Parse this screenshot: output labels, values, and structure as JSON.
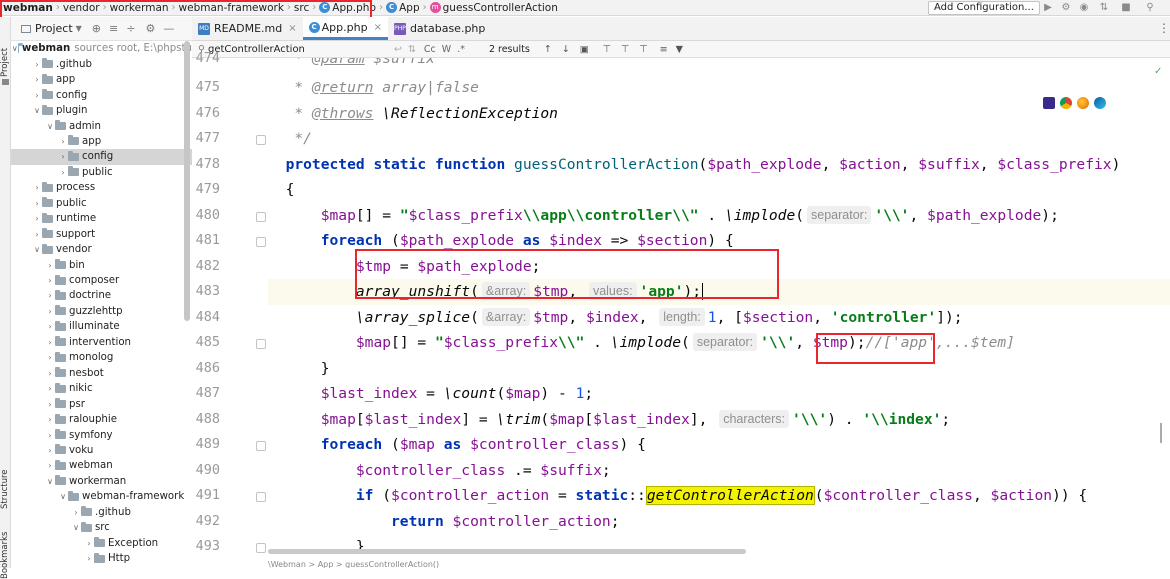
{
  "breadcrumb": [
    "webman",
    "vendor",
    "workerman",
    "webman-framework",
    "src",
    "App.php",
    "App",
    "guessControllerAction"
  ],
  "toolbar": {
    "add_config": "Add Configuration..."
  },
  "project_header": {
    "label": "Project"
  },
  "side_tabs": {
    "project": "Project",
    "structure": "Structure",
    "bookmarks": "Bookmarks"
  },
  "tree": [
    {
      "label": "webman",
      "extra": "sources root, E:\\phpstu",
      "indent": 0,
      "open": true,
      "bold": true
    },
    {
      "label": ".github",
      "indent": 1,
      "open": false
    },
    {
      "label": "app",
      "indent": 1,
      "open": false
    },
    {
      "label": "config",
      "indent": 1,
      "open": false
    },
    {
      "label": "plugin",
      "indent": 1,
      "open": true
    },
    {
      "label": "admin",
      "indent": 2,
      "open": true
    },
    {
      "label": "app",
      "indent": 3,
      "open": false
    },
    {
      "label": "config",
      "indent": 3,
      "open": false,
      "selected": true
    },
    {
      "label": "public",
      "indent": 3,
      "open": false
    },
    {
      "label": "process",
      "indent": 1,
      "open": false
    },
    {
      "label": "public",
      "indent": 1,
      "open": false
    },
    {
      "label": "runtime",
      "indent": 1,
      "open": false
    },
    {
      "label": "support",
      "indent": 1,
      "open": false
    },
    {
      "label": "vendor",
      "indent": 1,
      "open": true
    },
    {
      "label": "bin",
      "indent": 2,
      "open": false
    },
    {
      "label": "composer",
      "indent": 2,
      "open": false
    },
    {
      "label": "doctrine",
      "indent": 2,
      "open": false
    },
    {
      "label": "guzzlehttp",
      "indent": 2,
      "open": false
    },
    {
      "label": "illuminate",
      "indent": 2,
      "open": false
    },
    {
      "label": "intervention",
      "indent": 2,
      "open": false
    },
    {
      "label": "monolog",
      "indent": 2,
      "open": false
    },
    {
      "label": "nesbot",
      "indent": 2,
      "open": false
    },
    {
      "label": "nikic",
      "indent": 2,
      "open": false
    },
    {
      "label": "psr",
      "indent": 2,
      "open": false
    },
    {
      "label": "ralouphie",
      "indent": 2,
      "open": false
    },
    {
      "label": "symfony",
      "indent": 2,
      "open": false
    },
    {
      "label": "voku",
      "indent": 2,
      "open": false
    },
    {
      "label": "webman",
      "indent": 2,
      "open": false
    },
    {
      "label": "workerman",
      "indent": 2,
      "open": true
    },
    {
      "label": "webman-framework",
      "indent": 3,
      "open": true
    },
    {
      "label": ".github",
      "indent": 4,
      "open": false
    },
    {
      "label": "src",
      "indent": 4,
      "open": true
    },
    {
      "label": "Exception",
      "indent": 5,
      "open": false
    },
    {
      "label": "Http",
      "indent": 5,
      "open": false
    }
  ],
  "tabs": [
    {
      "label": "README.md",
      "icon": "MD"
    },
    {
      "label": "App.php",
      "icon": "C",
      "active": true
    },
    {
      "label": "database.php",
      "icon": "PHP"
    }
  ],
  "search": {
    "query": "getControllerAction",
    "results": "2 results",
    "cc": "Cc",
    "w": "W"
  },
  "line_numbers": [
    "474",
    "475",
    "476",
    "477",
    "478",
    "479",
    "480",
    "481",
    "482",
    "483",
    "484",
    "485",
    "486",
    "487",
    "488",
    "489",
    "490",
    "491",
    "492",
    "493"
  ],
  "hints": {
    "separator": "separator:",
    "array": "&array:",
    "values": "values:",
    "length": "length:",
    "characters": "characters:"
  },
  "code_comment": "//['app',...$tem]",
  "bottom_status": "\\Webman > App > guessControllerAction()"
}
